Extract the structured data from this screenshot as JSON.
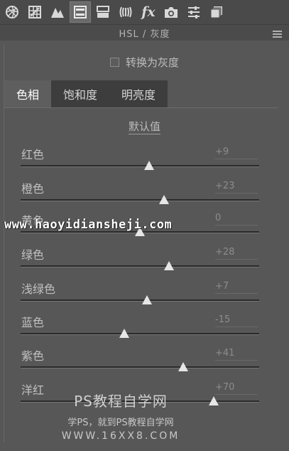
{
  "toolbar": {
    "icons": [
      "aperture-icon",
      "grid-icon",
      "mountains-icon",
      "hsl-icon",
      "split-toning-icon",
      "lens-icon",
      "fx-icon",
      "camera-icon",
      "sliders-icon",
      "presets-icon"
    ],
    "fx_label": "fx",
    "active_icon": "hsl-icon"
  },
  "section": {
    "title": "HSL / 灰度"
  },
  "grayscale": {
    "label": "转换为灰度",
    "checked": false
  },
  "tabs": [
    {
      "label": "色相",
      "active": true
    },
    {
      "label": "饱和度",
      "active": false
    },
    {
      "label": "明亮度",
      "active": false
    }
  ],
  "default_label": "默认值",
  "sliders": [
    {
      "label": "红色",
      "value": "+9",
      "numeric": 9
    },
    {
      "label": "橙色",
      "value": "+23",
      "numeric": 23
    },
    {
      "label": "黄色",
      "value": "0",
      "numeric": 0
    },
    {
      "label": "绿色",
      "value": "+28",
      "numeric": 28
    },
    {
      "label": "浅绿色",
      "value": "+7",
      "numeric": 7
    },
    {
      "label": "蓝色",
      "value": "-15",
      "numeric": -15
    },
    {
      "label": "紫色",
      "value": "+41",
      "numeric": 41
    },
    {
      "label": "洋红",
      "value": "+70",
      "numeric": 70
    }
  ],
  "watermark": {
    "url": "www.haoyidiansheji.com",
    "title": "PS教程自学网",
    "subtitle": "学PS，就到PS教程自学网",
    "site": "WWW.16XX8.COM"
  },
  "colors": {
    "panel_bg": "#575757",
    "toolbar_bg": "#4a4a4a",
    "tab_inactive_bg": "#3d3d3d",
    "tab_active_bg": "#5e5e5e",
    "thumb": "#e6e6e6"
  }
}
